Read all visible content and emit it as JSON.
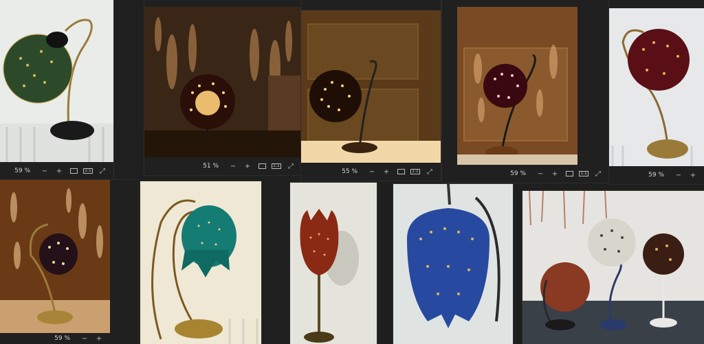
{
  "windows": [
    {
      "id": "w1",
      "zoom": "59 %"
    },
    {
      "id": "w2",
      "zoom": "51 %"
    },
    {
      "id": "w3",
      "zoom": "55 %"
    },
    {
      "id": "w4",
      "zoom": "59 %"
    },
    {
      "id": "w5",
      "zoom": "59 %"
    },
    {
      "id": "w6",
      "zoom": "59 %"
    }
  ],
  "icons": {
    "zoom_out": "zoom-out-icon",
    "zoom_in": "zoom-in-icon",
    "fit": "fit-to-window-icon",
    "actual": "actual-size-icon",
    "fullscreen": "fullscreen-icon"
  },
  "toolbar": {
    "actual_label": "1:1"
  }
}
